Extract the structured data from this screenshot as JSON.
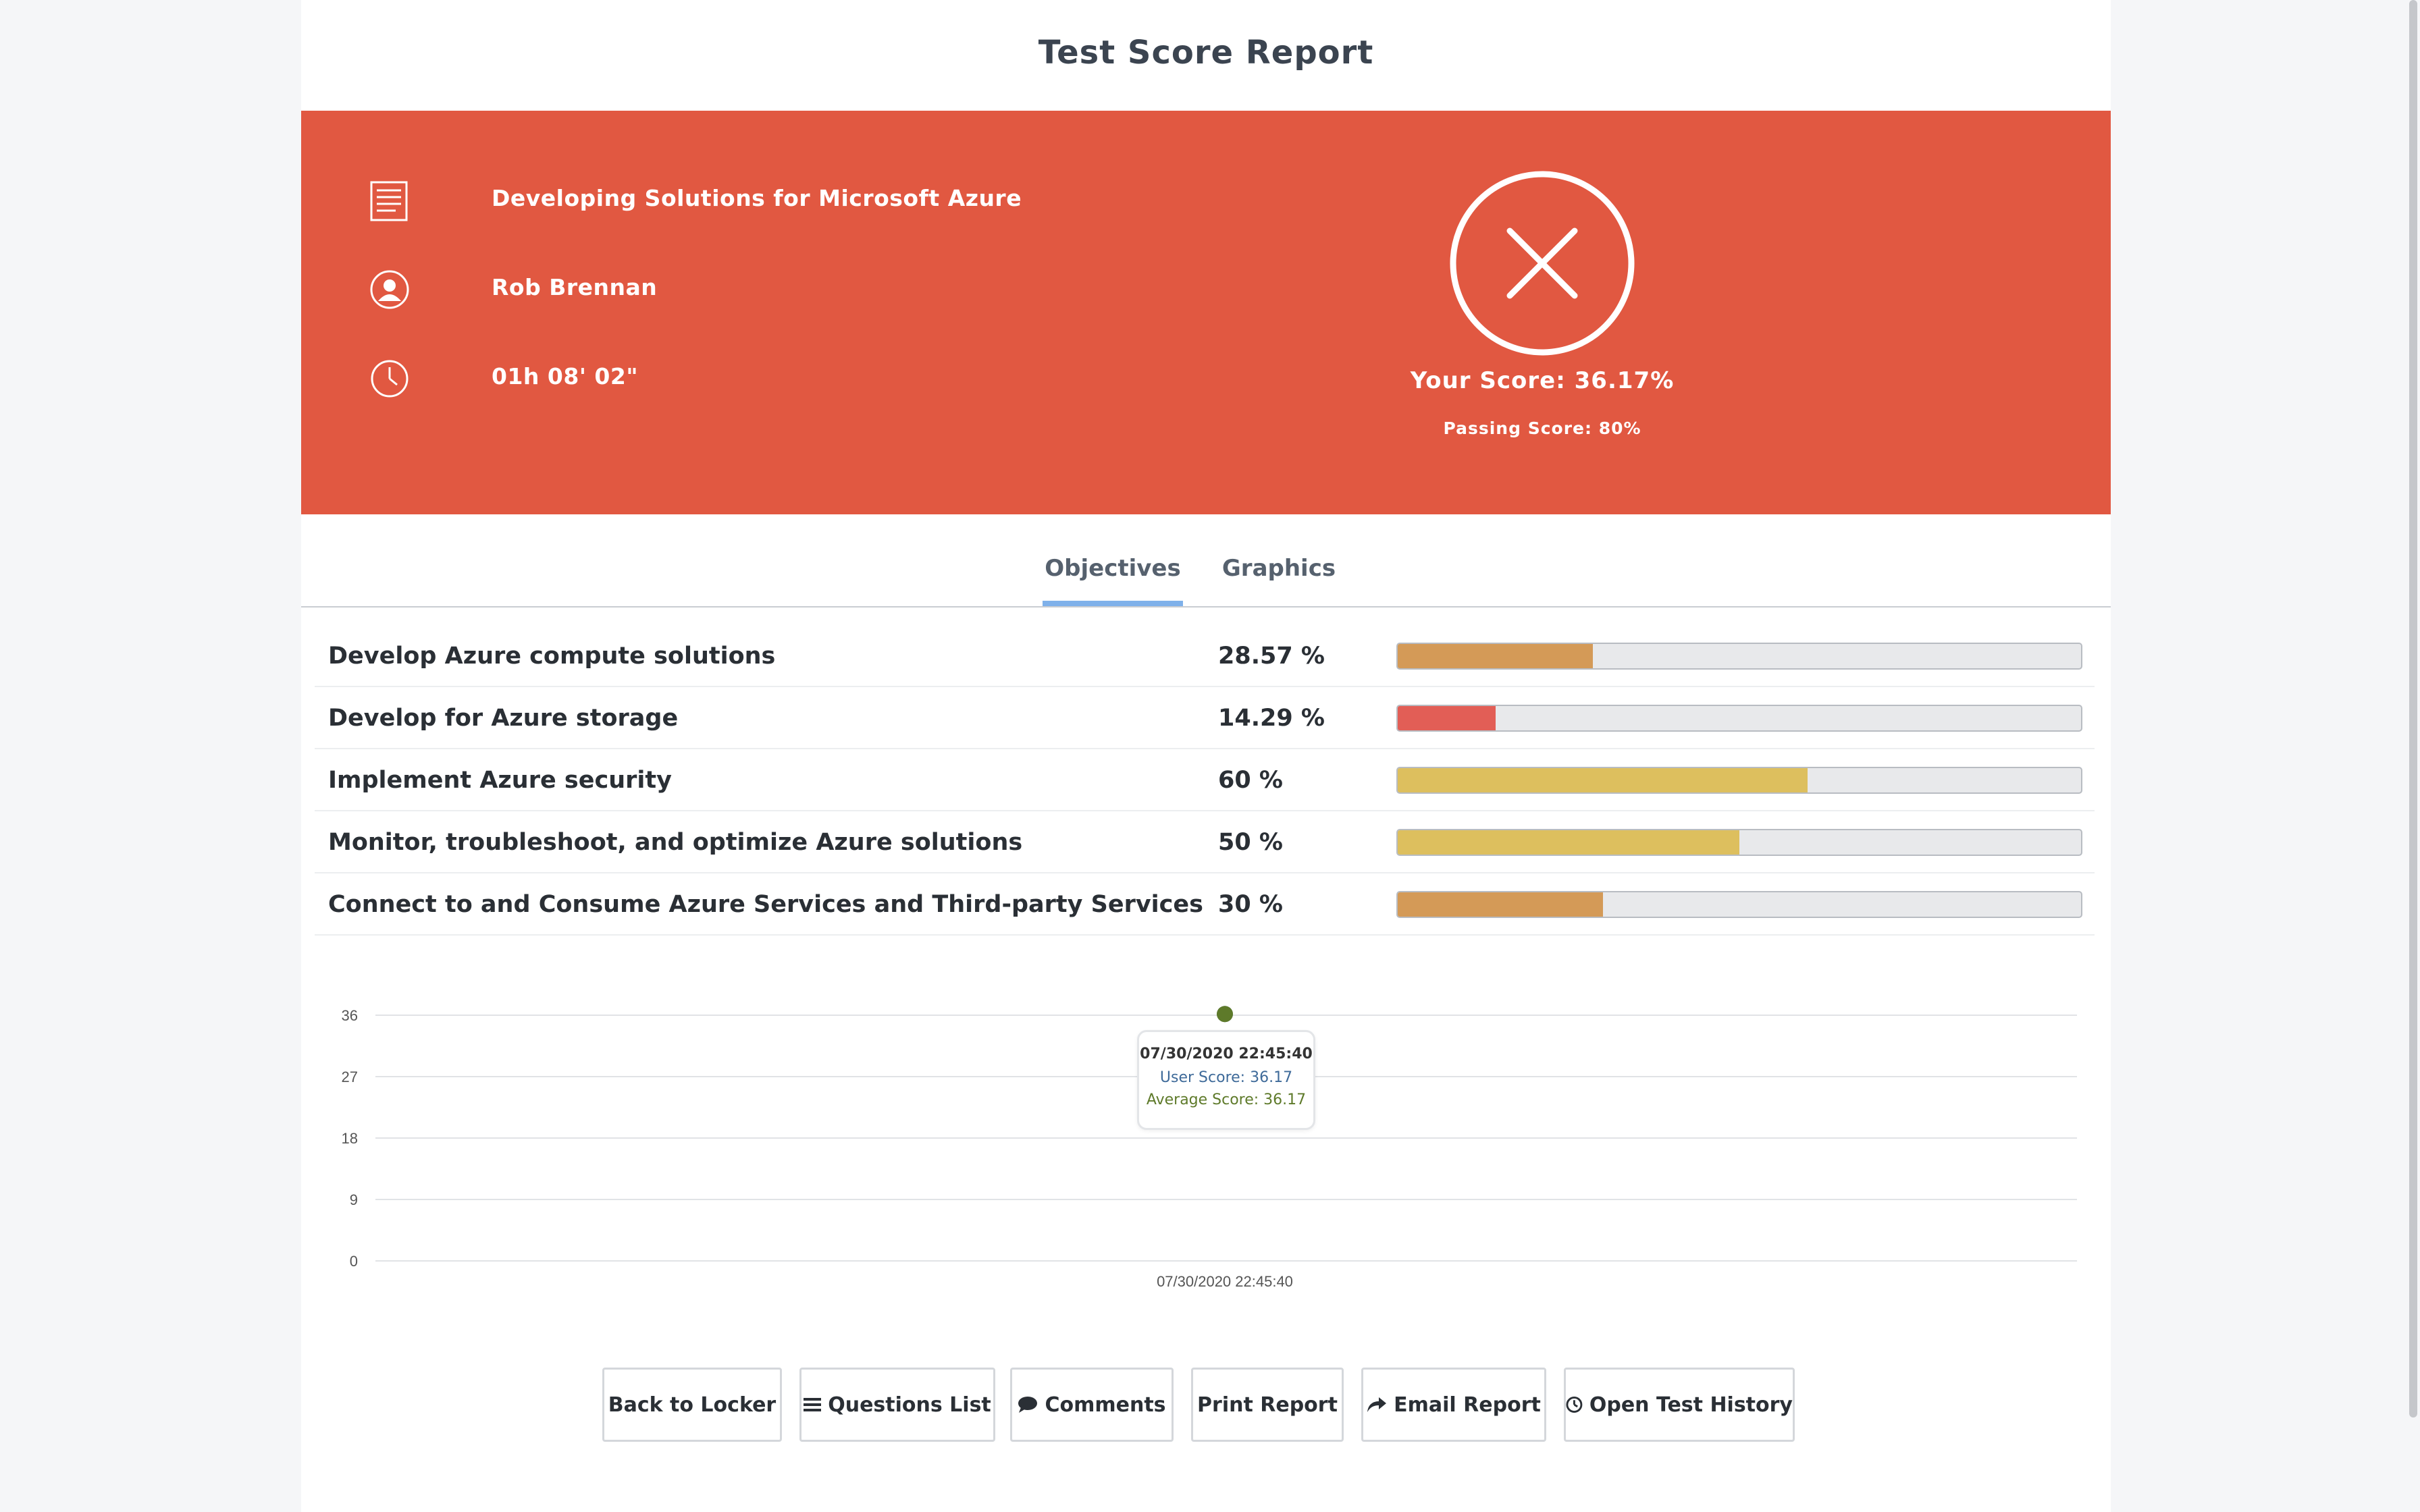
{
  "page": {
    "title": "Test Score Report"
  },
  "summary": {
    "exam_name": "Developing Solutions for Microsoft Azure",
    "user_name": "Rob Brennan",
    "duration": "01h 08' 02\"",
    "your_score": "Your Score: 36.17%",
    "passing_score": "Passing Score: 80%",
    "status_icon": "fail-x-icon",
    "banner_color": "#e15841"
  },
  "tabs": [
    {
      "label": "Objectives",
      "active": true
    },
    {
      "label": "Graphics",
      "active": false
    }
  ],
  "objectives": [
    {
      "name": "Develop Azure compute solutions",
      "percent_label": "28.57 %",
      "percent": 28.57,
      "color": "#d49a57"
    },
    {
      "name": "Develop for Azure storage",
      "percent_label": "14.29 %",
      "percent": 14.29,
      "color": "#e25e56"
    },
    {
      "name": "Implement Azure security",
      "percent_label": "60 %",
      "percent": 60,
      "color": "#ddbf5e"
    },
    {
      "name": "Monitor, troubleshoot, and optimize Azure solutions",
      "percent_label": "50 %",
      "percent": 50,
      "color": "#ddbf5e"
    },
    {
      "name": "Connect to and Consume Azure Services and Third-party Services",
      "percent_label": "30 %",
      "percent": 30,
      "color": "#d49a57"
    }
  ],
  "chart_data": {
    "type": "line",
    "x": [
      "07/30/2020 22:45:40"
    ],
    "series": [
      {
        "name": "User Score",
        "values": [
          36.17
        ],
        "color": "#5a7a93"
      },
      {
        "name": "Average Score",
        "values": [
          36.17
        ],
        "color": "#5e7a2a"
      }
    ],
    "yticks": [
      0,
      9,
      18,
      27,
      36
    ],
    "ylim": [
      0,
      36
    ],
    "grid": true
  },
  "tooltip": {
    "date": "07/30/2020 22:45:40",
    "user_score": "User Score: 36.17",
    "average_score": "Average Score: 36.17"
  },
  "buttons": [
    {
      "label": "Back to Locker",
      "icon": ""
    },
    {
      "label": "Questions List",
      "icon": "list-icon"
    },
    {
      "label": "Comments",
      "icon": "comment-icon"
    },
    {
      "label": "Print Report",
      "icon": ""
    },
    {
      "label": "Email Report",
      "icon": "share-icon"
    },
    {
      "label": "Open Test History",
      "icon": "clock-icon"
    }
  ]
}
